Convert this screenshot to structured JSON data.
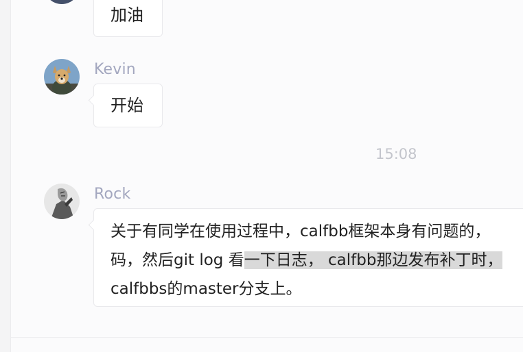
{
  "messages": [
    {
      "sender": "",
      "text": "加油"
    },
    {
      "sender": "Kevin",
      "text": "开始"
    }
  ],
  "timestamp": "15:08",
  "rock_message": {
    "sender": "Rock",
    "line1": "关于有同学在使用过程中，calfbb框架本身有问题的，",
    "line2_a": "码，然后git log 看",
    "line2_highlight": "一下日志， calfbb那边发布补丁时，",
    "line3": "calfbbs的master分支上。"
  },
  "colors": {
    "background": "#fbfbfc",
    "sender_name": "#a3a7bf",
    "timestamp": "#c3c5cc",
    "highlight": "#d9d9d9"
  }
}
